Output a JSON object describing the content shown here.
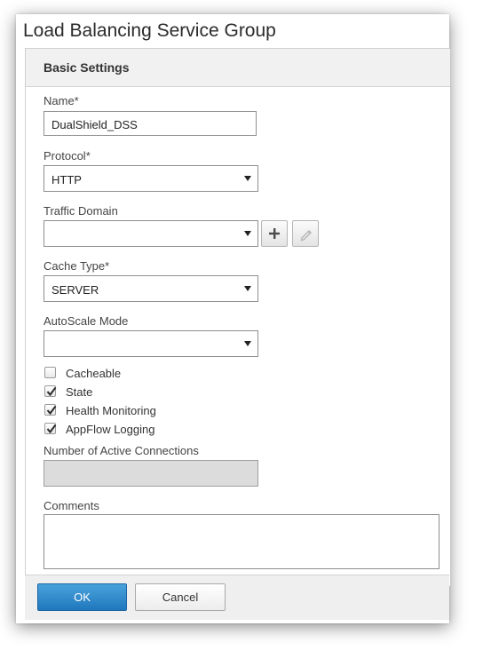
{
  "dialog": {
    "title": "Load Balancing Service Group"
  },
  "basic_settings": {
    "header": "Basic Settings",
    "name": {
      "label": "Name*",
      "value": "DualShield_DSS"
    },
    "protocol": {
      "label": "Protocol*",
      "value": "HTTP"
    },
    "traffic_domain": {
      "label": "Traffic Domain",
      "value": ""
    },
    "cache_type": {
      "label": "Cache Type*",
      "value": "SERVER"
    },
    "autoscale_mode": {
      "label": "AutoScale Mode",
      "value": ""
    },
    "checkboxes": [
      {
        "label": "Cacheable",
        "checked": false
      },
      {
        "label": "State",
        "checked": true
      },
      {
        "label": "Health Monitoring",
        "checked": true
      },
      {
        "label": "AppFlow Logging",
        "checked": true
      }
    ],
    "active_connections": {
      "label": "Number of Active Connections",
      "value": ""
    },
    "comments": {
      "label": "Comments",
      "value": ""
    }
  },
  "footer": {
    "ok_label": "OK",
    "cancel_label": "Cancel"
  },
  "colors": {
    "primary_button": "#2a86c9",
    "header_bg": "#f1f1f1",
    "disabled_field": "#dcdcdc"
  },
  "icons": {
    "add": "plus-icon",
    "edit": "pencil-icon",
    "dropdown": "caret-down-icon",
    "check": "check-icon"
  }
}
